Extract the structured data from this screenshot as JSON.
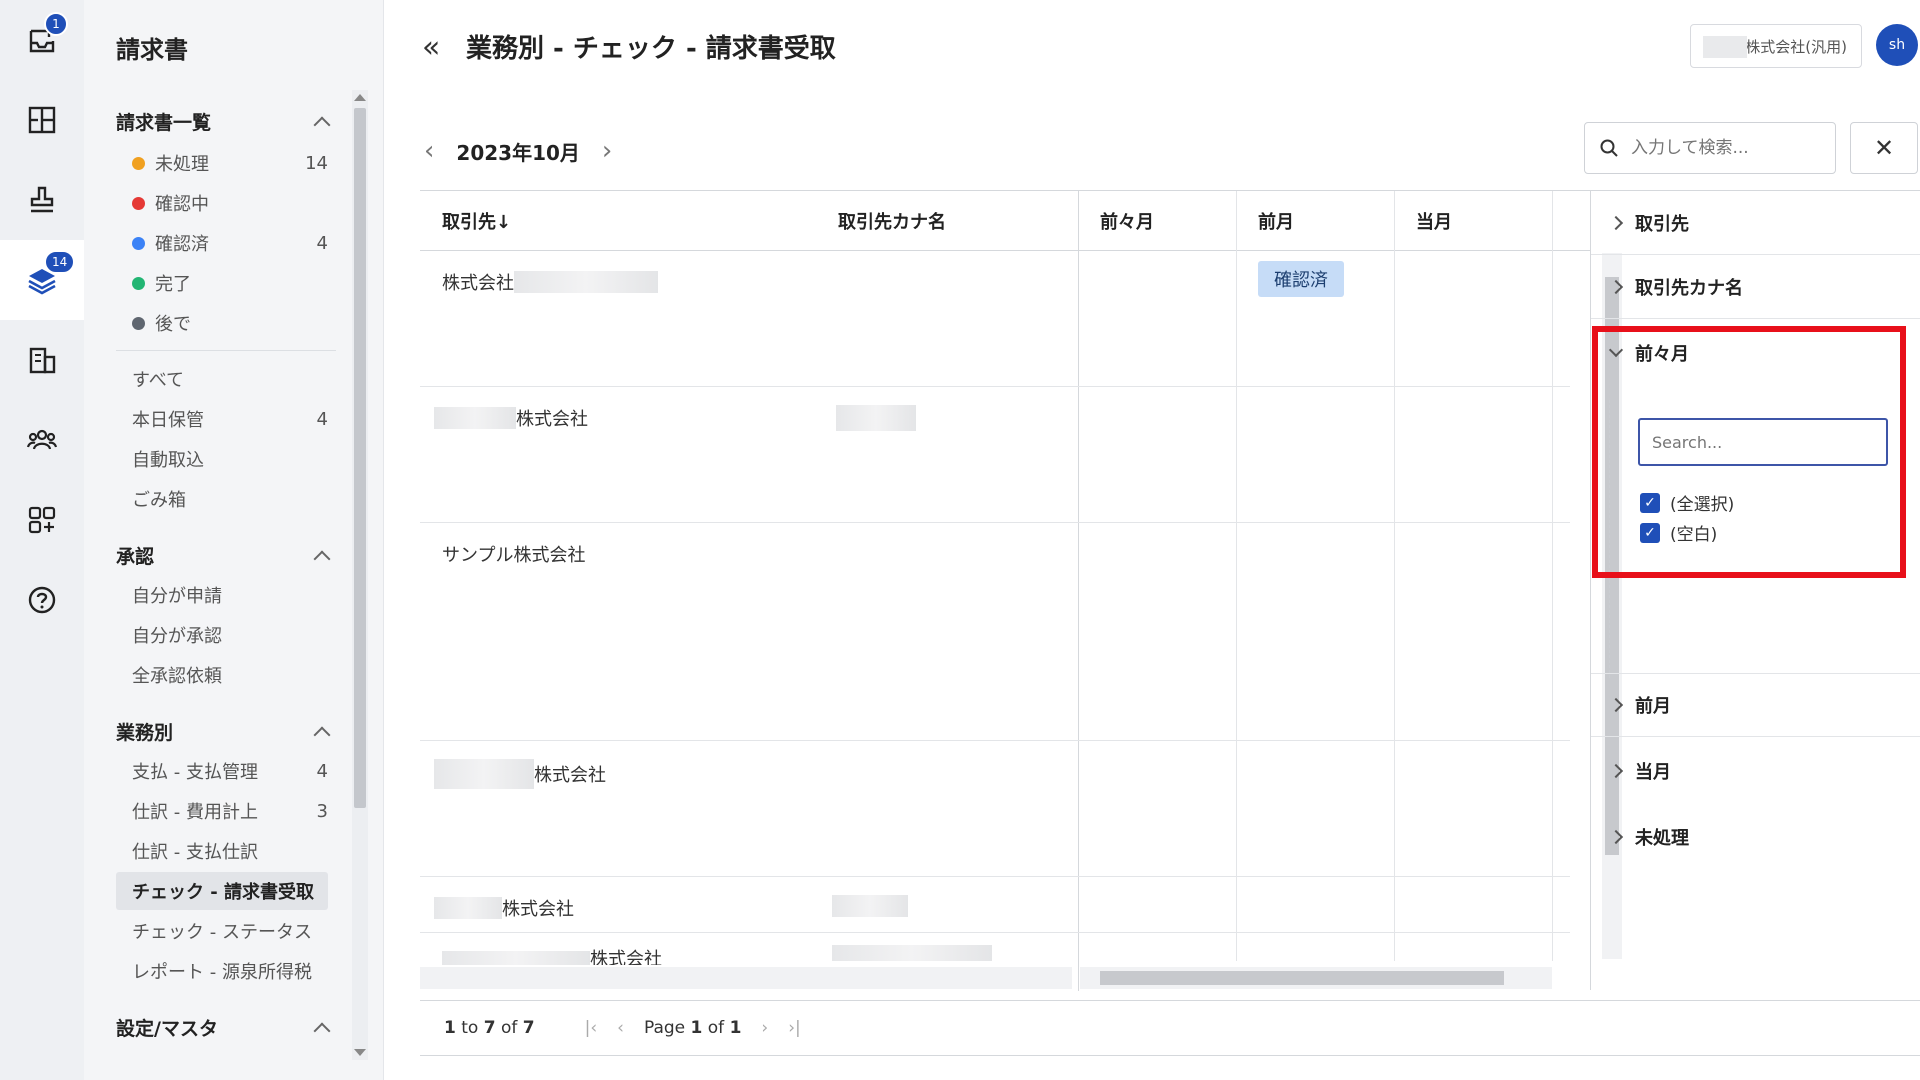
{
  "rail": {
    "inbox_badge": "1",
    "layers_badge": "14"
  },
  "sidebar": {
    "title": "請求書",
    "sections": {
      "list": {
        "title": "請求書一覧",
        "items": [
          {
            "label": "未処理",
            "count": "14",
            "color": "#f0a020"
          },
          {
            "label": "確認中",
            "count": "",
            "color": "#e53935"
          },
          {
            "label": "確認済",
            "count": "4",
            "color": "#3b82f6"
          },
          {
            "label": "完了",
            "count": "",
            "color": "#22b573"
          },
          {
            "label": "後で",
            "count": "",
            "color": "#5f6670"
          }
        ],
        "others": [
          {
            "label": "すべて",
            "count": ""
          },
          {
            "label": "本日保管",
            "count": "4"
          },
          {
            "label": "自動取込",
            "count": ""
          },
          {
            "label": "ごみ箱",
            "count": ""
          }
        ]
      },
      "approval": {
        "title": "承認",
        "items": [
          {
            "label": "自分が申請"
          },
          {
            "label": "自分が承認"
          },
          {
            "label": "全承認依頼"
          }
        ]
      },
      "business": {
        "title": "業務別",
        "items": [
          {
            "label": "支払 - 支払管理",
            "count": "4"
          },
          {
            "label": "仕訳 - 費用計上",
            "count": "3"
          },
          {
            "label": "仕訳 - 支払仕訳",
            "count": ""
          },
          {
            "label": "チェック - 請求書受取",
            "count": ""
          },
          {
            "label": "チェック - ステータス",
            "count": ""
          },
          {
            "label": "レポート - 源泉所得税",
            "count": ""
          }
        ]
      },
      "settings": {
        "title": "設定/マスタ"
      }
    }
  },
  "header": {
    "title": "業務別 - チェック - 請求書受取",
    "company": "株式会社(汎用)",
    "avatar": "sh"
  },
  "toolbar": {
    "month": "2023年10月",
    "search_placeholder": "入力して検索..."
  },
  "grid": {
    "columns": [
      "取引先↓",
      "取引先カナ名",
      "前々月",
      "前月",
      "当月"
    ],
    "rows": [
      {
        "name": "株式会社",
        "status": "確認済"
      },
      {
        "name": "株式会社",
        "status": ""
      },
      {
        "name": "サンプル株式会社",
        "status": ""
      },
      {
        "name": "株式会社",
        "status": ""
      },
      {
        "name": "株式会社",
        "status": ""
      },
      {
        "name": "株式会社",
        "status": ""
      }
    ]
  },
  "pager": {
    "count_prefix": "1",
    "count_mid": " to ",
    "count_end": "7",
    "count_of": " of ",
    "count_total": "7",
    "page_label": "Page ",
    "page": "1",
    "of_label": " of ",
    "pages": "1"
  },
  "filter_panel": {
    "items": [
      "取引先",
      "取引先カナ名",
      "前々月",
      "前月",
      "当月",
      "未処理"
    ],
    "expanded": "前々月",
    "search_placeholder": "Search...",
    "options": [
      "(全選択)",
      "(空白)"
    ]
  },
  "colors": {
    "accent": "#1f4fb8",
    "highlight": "#e8101a",
    "badge_bg": "#c6dcf7"
  }
}
